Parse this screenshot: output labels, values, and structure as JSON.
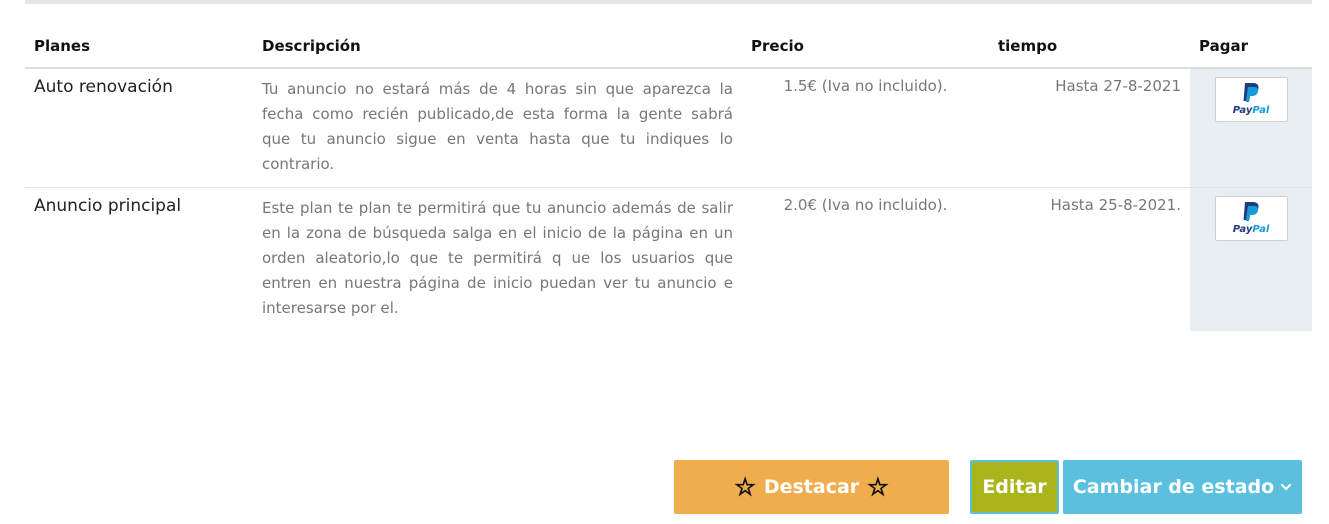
{
  "table": {
    "headers": [
      "Planes",
      "Descripción",
      "Precio",
      "tiempo",
      "Pagar"
    ],
    "rows": [
      {
        "plan": "Auto renovación",
        "description": "Tu anuncio no estará más de 4 horas sin que aparezca la fecha como recién publicado,de esta forma la gente sabrá que tu anuncio sigue en venta hasta que tu indiques lo contrario.",
        "price": "1.5€ (Iva no incluido).",
        "time": "Hasta 27-8-2021",
        "pay_label": "PayPal"
      },
      {
        "plan": "Anuncio principal",
        "description": "Este plan te plan te permitirá que tu anuncio además de salir en la zona de búsqueda salga en el inicio de la página en un orden aleatorio,lo que te permitirá q ue los usuarios que entren en nuestra página de inicio puedan ver tu anuncio e interesarse por el.",
        "price": "2.0€ (Iva no incluido).",
        "time": "Hasta 25-8-2021.",
        "pay_label": "PayPal"
      }
    ]
  },
  "actions": {
    "destacar_label": "Destacar",
    "star_glyph": "☆",
    "editar_label": "Editar",
    "estado_label": "Cambiar de estado",
    "estado_icon": "chevron-down-icon"
  },
  "colors": {
    "destacar": "#f0ad4e",
    "editar": "#aab51b",
    "estado": "#5bc0de",
    "pay_cell": "#e8eef2",
    "paypal_blue": "#253b80",
    "paypal_light": "#179bd7"
  }
}
